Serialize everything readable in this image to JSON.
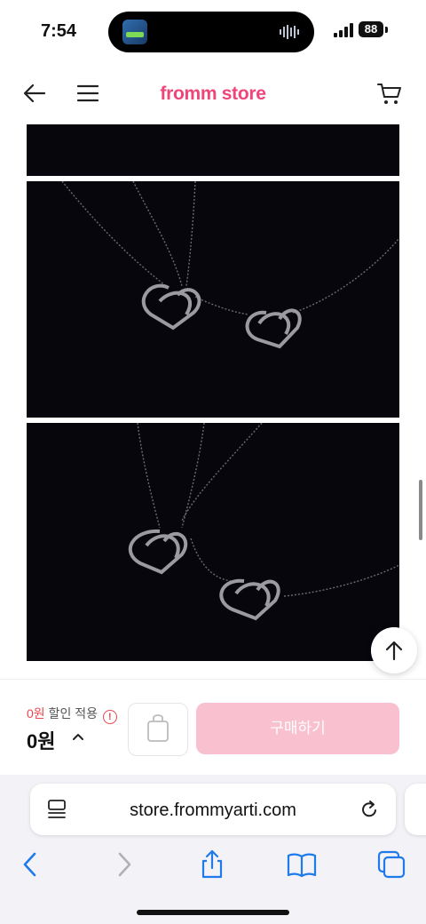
{
  "status_bar": {
    "time": "7:54",
    "battery": "88"
  },
  "header": {
    "brand": "fromm store",
    "brand_color": "#f0457a"
  },
  "purchase": {
    "discount_amount": "0원",
    "discount_label": " 할인 적용",
    "price": "0원",
    "buy_label": "구매하기",
    "buy_button_color": "#f9c0cf"
  },
  "browser": {
    "url": "store.frommyarti.com"
  },
  "icons": {
    "back": "arrow-left-icon",
    "menu": "hamburger-menu-icon",
    "cart": "cart-icon",
    "scroll_top": "arrow-up-icon",
    "bag": "shopping-bag-icon",
    "reader": "reader-mode-icon",
    "reload": "reload-icon",
    "nav_back": "chevron-left-icon",
    "nav_forward": "chevron-right-icon",
    "share": "share-icon",
    "bookmarks": "book-icon",
    "tabs": "tabs-icon"
  }
}
